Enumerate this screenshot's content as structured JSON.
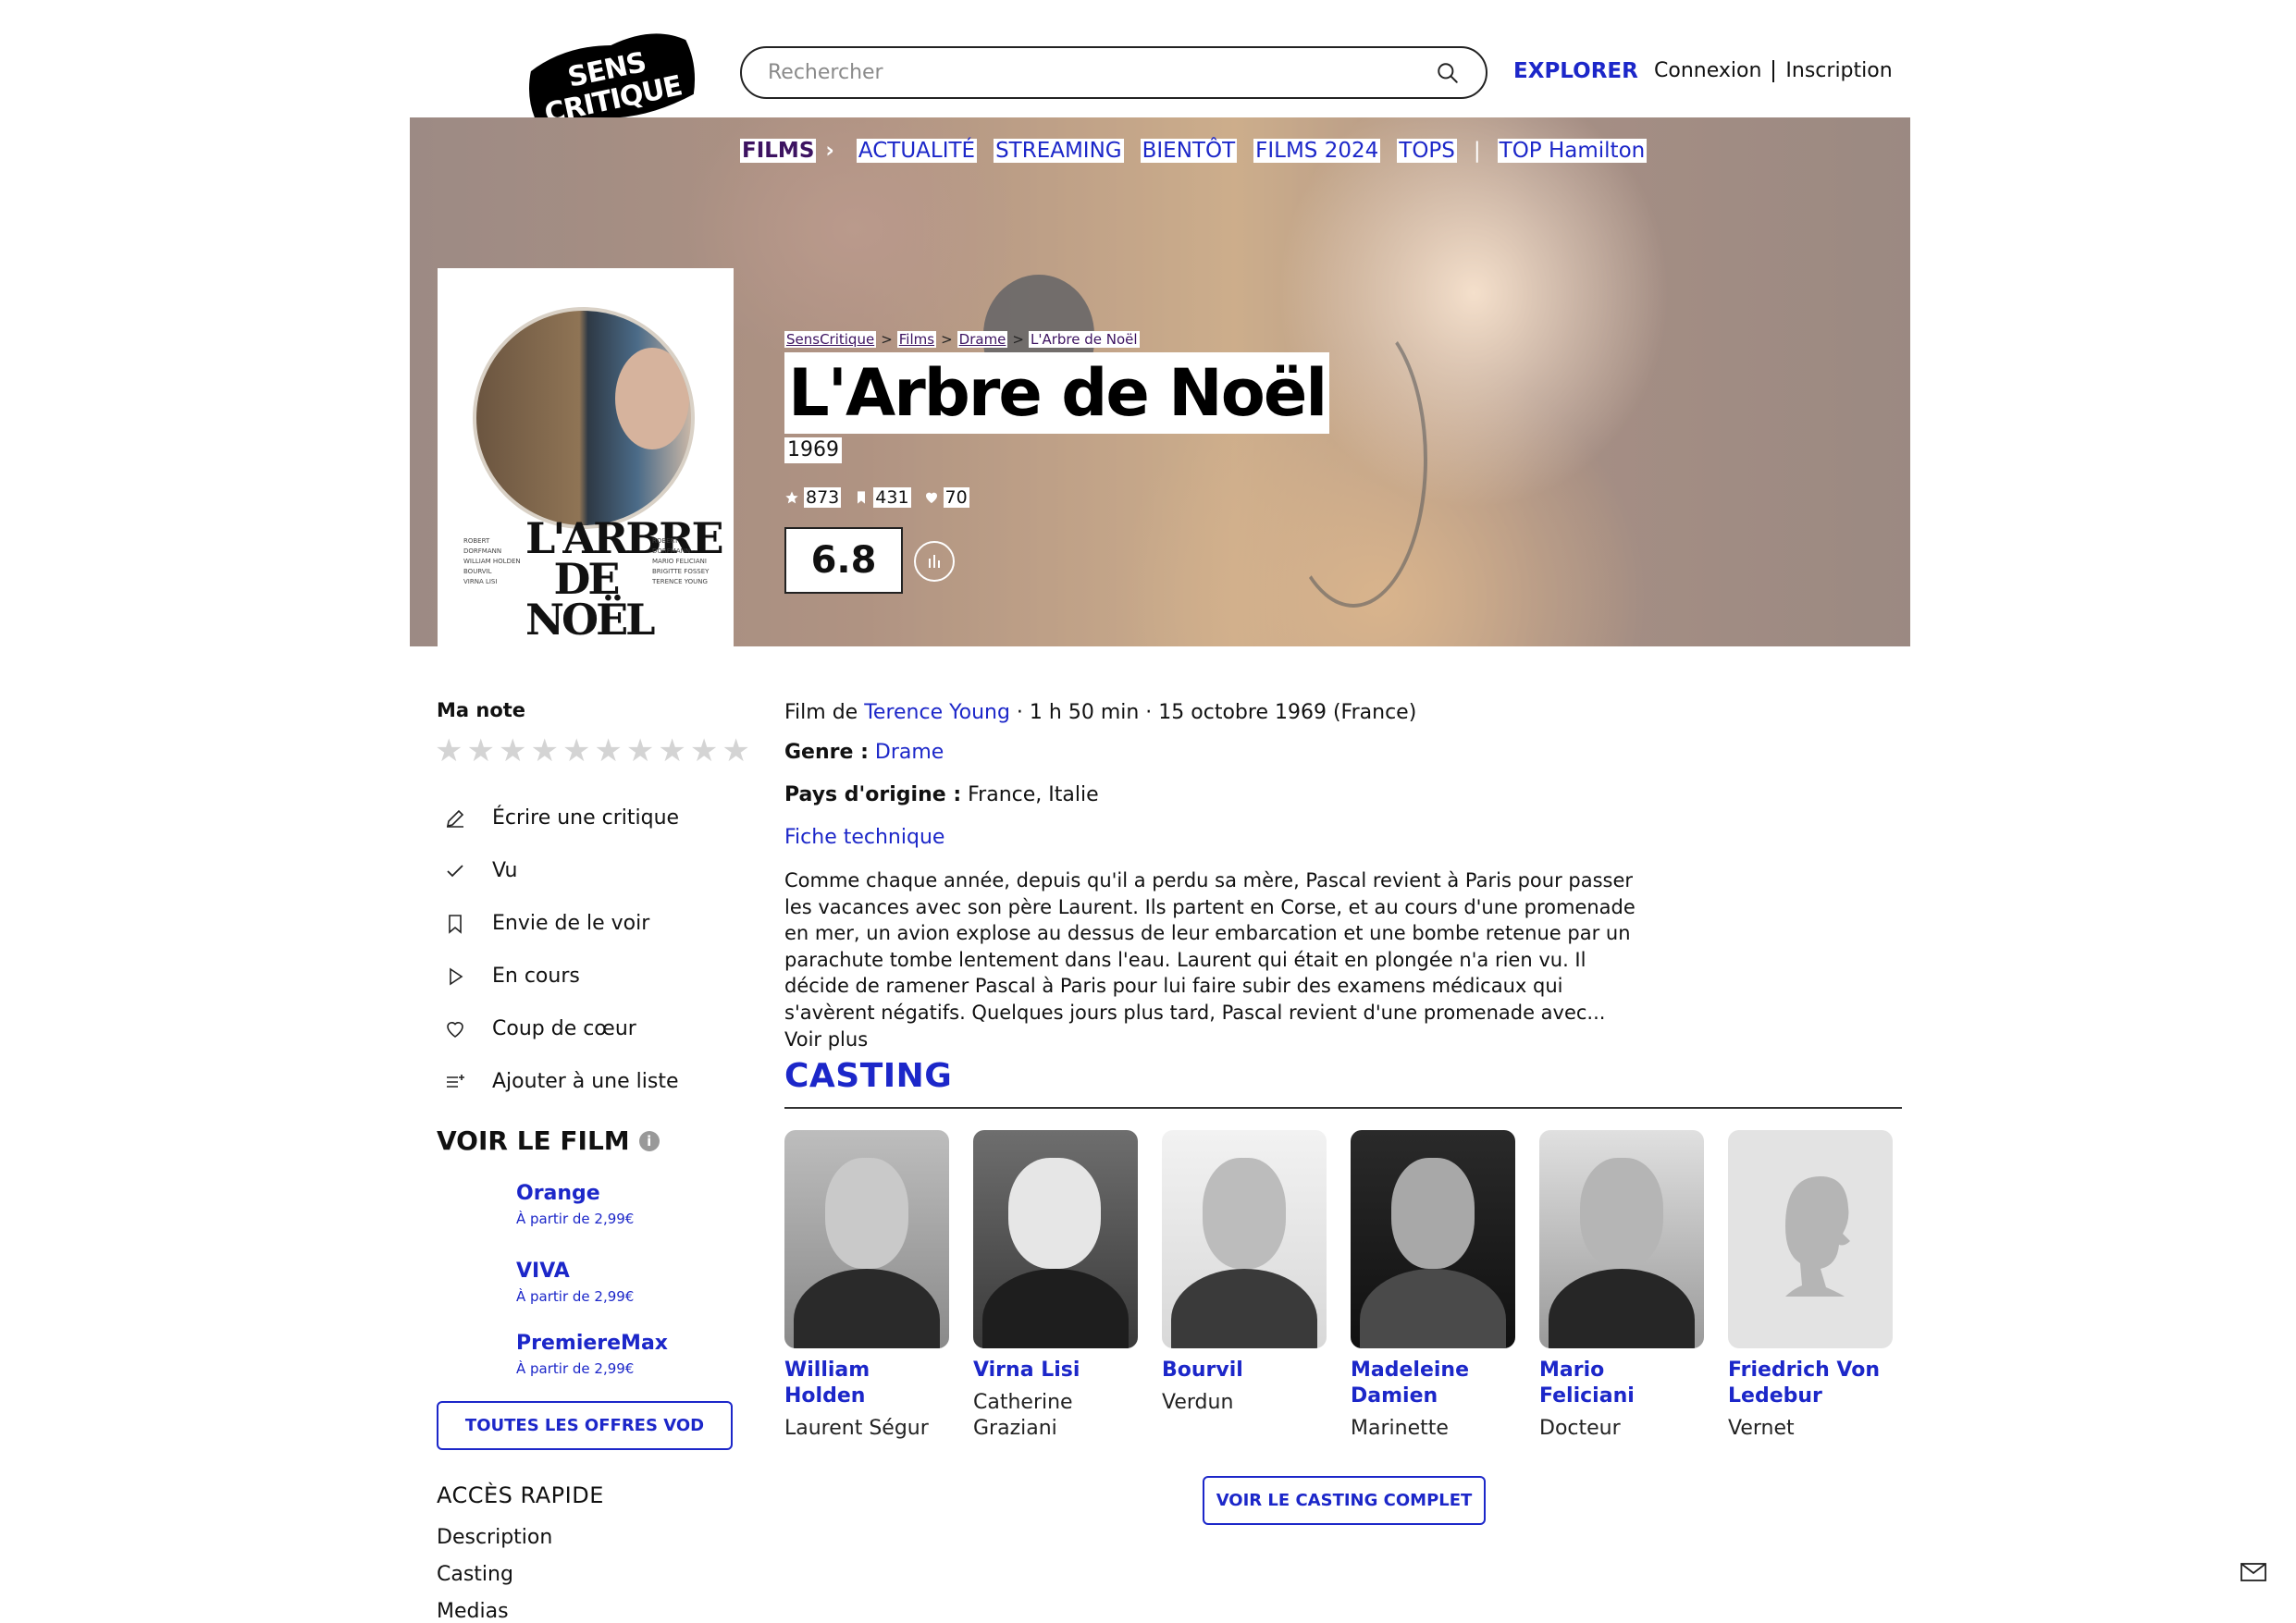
{
  "header": {
    "logo_text": "SENS CRITIQUE",
    "search_placeholder": "Rechercher",
    "explorer": "EXPLORER",
    "login": "Connexion",
    "signup": "Inscription"
  },
  "nav": {
    "films": "FILMS",
    "items": [
      "ACTUALITÉ",
      "STREAMING",
      "BIENTÔT",
      "FILMS 2024",
      "TOPS"
    ],
    "top": "TOP Hamilton"
  },
  "breadcrumb": [
    "SensCritique",
    "Films",
    "Drame",
    "L'Arbre de Noël"
  ],
  "movie": {
    "title": "L'Arbre de Noël",
    "year": "1969",
    "ratings_count": "873",
    "wishes_count": "431",
    "favorites_count": "70",
    "score": "6.8",
    "poster_title": "L'ARBRE DE NOËL",
    "meta_prefix": "Film de ",
    "director": "Terence Young",
    "meta_suffix": " · 1 h 50 min · 15 octobre 1969 (France)",
    "genre_label": "Genre :",
    "genre": "Drame",
    "country_label": "Pays d'origine :",
    "country": "France, Italie",
    "tech_sheet": "Fiche technique",
    "synopsis": "Comme chaque année, depuis qu'il a perdu sa mère, Pascal revient à Paris pour passer les vacances avec son père Laurent. Ils partent en Corse, et au cours d'une promenade en mer, un avion explose au dessus de leur embarcation et une bombe retenue par un parachute tombe lentement dans l'eau. Laurent qui était en plongée n'a rien vu. Il décide de ramener Pascal à Paris pour lui faire subir des examens médicaux qui s'avèrent négatifs. Quelques jours plus tard, Pascal revient d'une promenade avec... Voir plus"
  },
  "sidebar": {
    "my_rating": "Ma note",
    "stars_total": 10,
    "actions": [
      "Écrire une critique",
      "Vu",
      "Envie de le voir",
      "En cours",
      "Coup de cœur",
      "Ajouter à une liste"
    ],
    "watch_title": "VOIR LE FILM",
    "offers": [
      {
        "name": "Orange",
        "price": "À partir de 2,99€"
      },
      {
        "name": "VIVA",
        "price": "À partir de 2,99€"
      },
      {
        "name": "PremiereMax",
        "price": "À partir de 2,99€"
      }
    ],
    "all_offers": "TOUTES LES OFFRES VOD",
    "quick_access": "ACCÈS RAPIDE",
    "quick_links": [
      "Description",
      "Casting",
      "Medias"
    ]
  },
  "casting": {
    "title": "CASTING",
    "cast": [
      {
        "name": "William Holden",
        "role": "Laurent Ségur"
      },
      {
        "name": "Virna Lisi",
        "role": "Catherine Graziani"
      },
      {
        "name": "Bourvil",
        "role": "Verdun"
      },
      {
        "name": "Madeleine Damien",
        "role": "Marinette"
      },
      {
        "name": "Mario Feliciani",
        "role": "Docteur"
      },
      {
        "name": "Friedrich Von Ledebur",
        "role": "Vernet"
      }
    ],
    "full_button": "VOIR LE CASTING COMPLET"
  },
  "colors": {
    "accent": "#1c27c9",
    "nav_active": "#3d1361"
  }
}
